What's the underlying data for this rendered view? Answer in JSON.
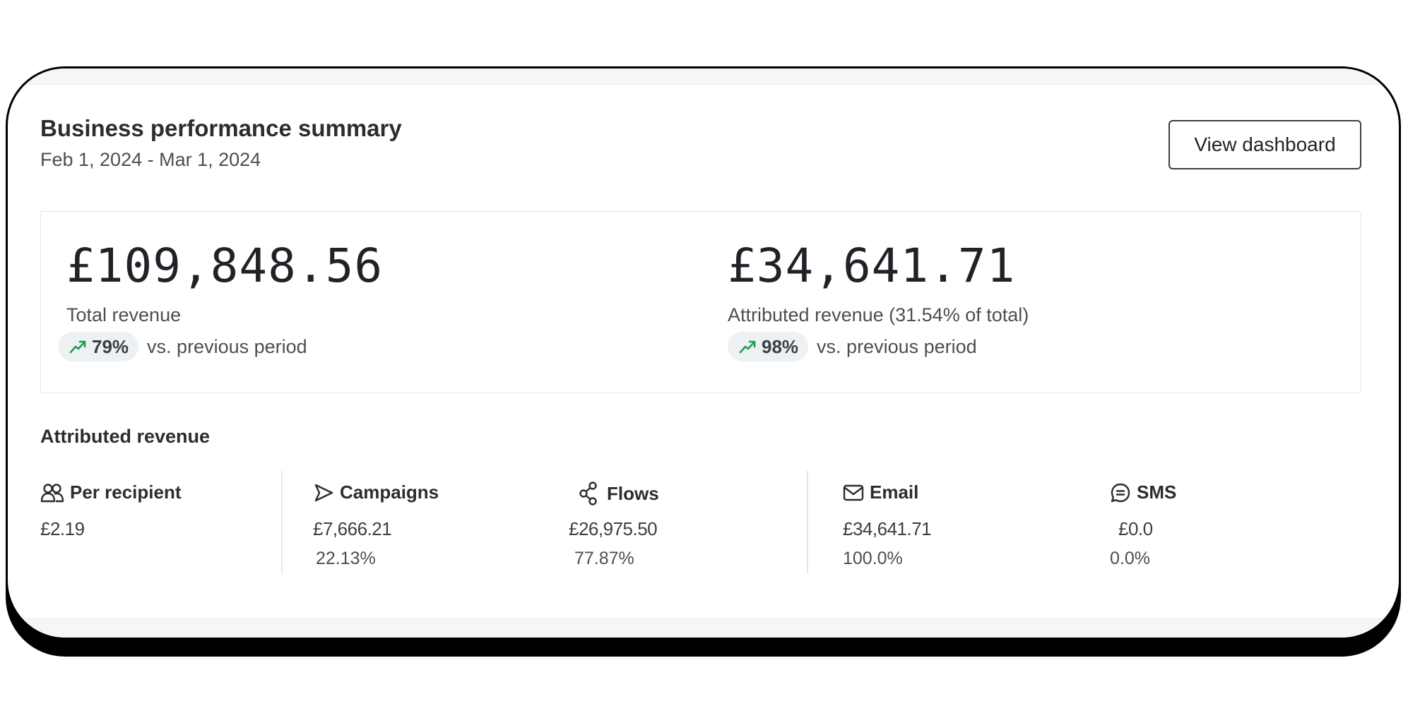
{
  "header": {
    "title": "Business performance summary",
    "date_range": "Feb 1, 2024 - Mar 1, 2024",
    "view_dashboard_label": "View dashboard"
  },
  "summary": {
    "total": {
      "value": "£109,848.56",
      "label": "Total revenue",
      "delta": "79%",
      "delta_icon": "trend-up-icon",
      "delta_text": "vs. previous period"
    },
    "attributed": {
      "value": "£34,641.71",
      "label": "Attributed revenue (31.54% of total)",
      "delta": "98%",
      "delta_icon": "trend-up-icon",
      "delta_text": "vs. previous period"
    }
  },
  "attributed_section": {
    "title": "Attributed revenue",
    "channels": [
      {
        "label": "Per recipient",
        "icon": "users-icon",
        "value": "£2.19",
        "percent": ""
      },
      {
        "label": "Campaigns",
        "icon": "send-icon",
        "value": "£7,666.21",
        "percent": "22.13%"
      },
      {
        "label": "Flows",
        "icon": "flow-icon",
        "value": "£26,975.50",
        "percent": "77.87%"
      },
      {
        "label": "Email",
        "icon": "mail-icon",
        "value": "£34,641.71",
        "percent": "100.0%"
      },
      {
        "label": "SMS",
        "icon": "chat-icon",
        "value": "£0.0",
        "percent": "0.0%"
      }
    ]
  },
  "colors": {
    "trend_up": "#1f9d57",
    "pill_bg": "#eef1f3",
    "border": "#dfe3e7",
    "frame": "#000000"
  }
}
